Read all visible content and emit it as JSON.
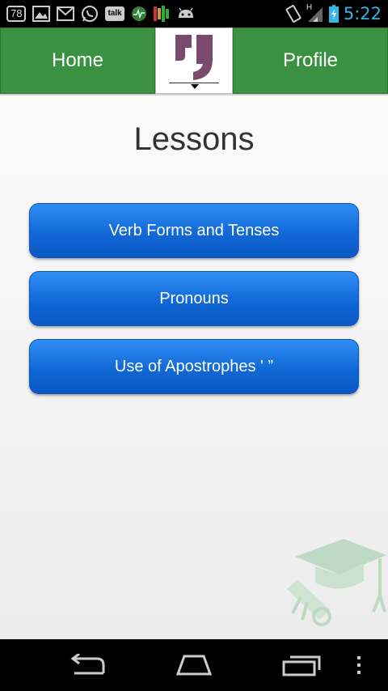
{
  "status_bar": {
    "notification_badge": "78",
    "talk_label": "talk",
    "network_label": "H",
    "time": "5:22"
  },
  "top_nav": {
    "home_label": "Home",
    "profile_label": "Profile"
  },
  "main": {
    "title": "Lessons",
    "lessons": [
      {
        "label": "Verb Forms and Tenses"
      },
      {
        "label": "Pronouns"
      },
      {
        "label": "Use of Apostrophes ' ”"
      }
    ]
  },
  "colors": {
    "nav_green": "#3b9142",
    "button_blue": "#1168d6",
    "time_blue": "#33b5e5",
    "logo_purple": "#7a4a6e"
  }
}
